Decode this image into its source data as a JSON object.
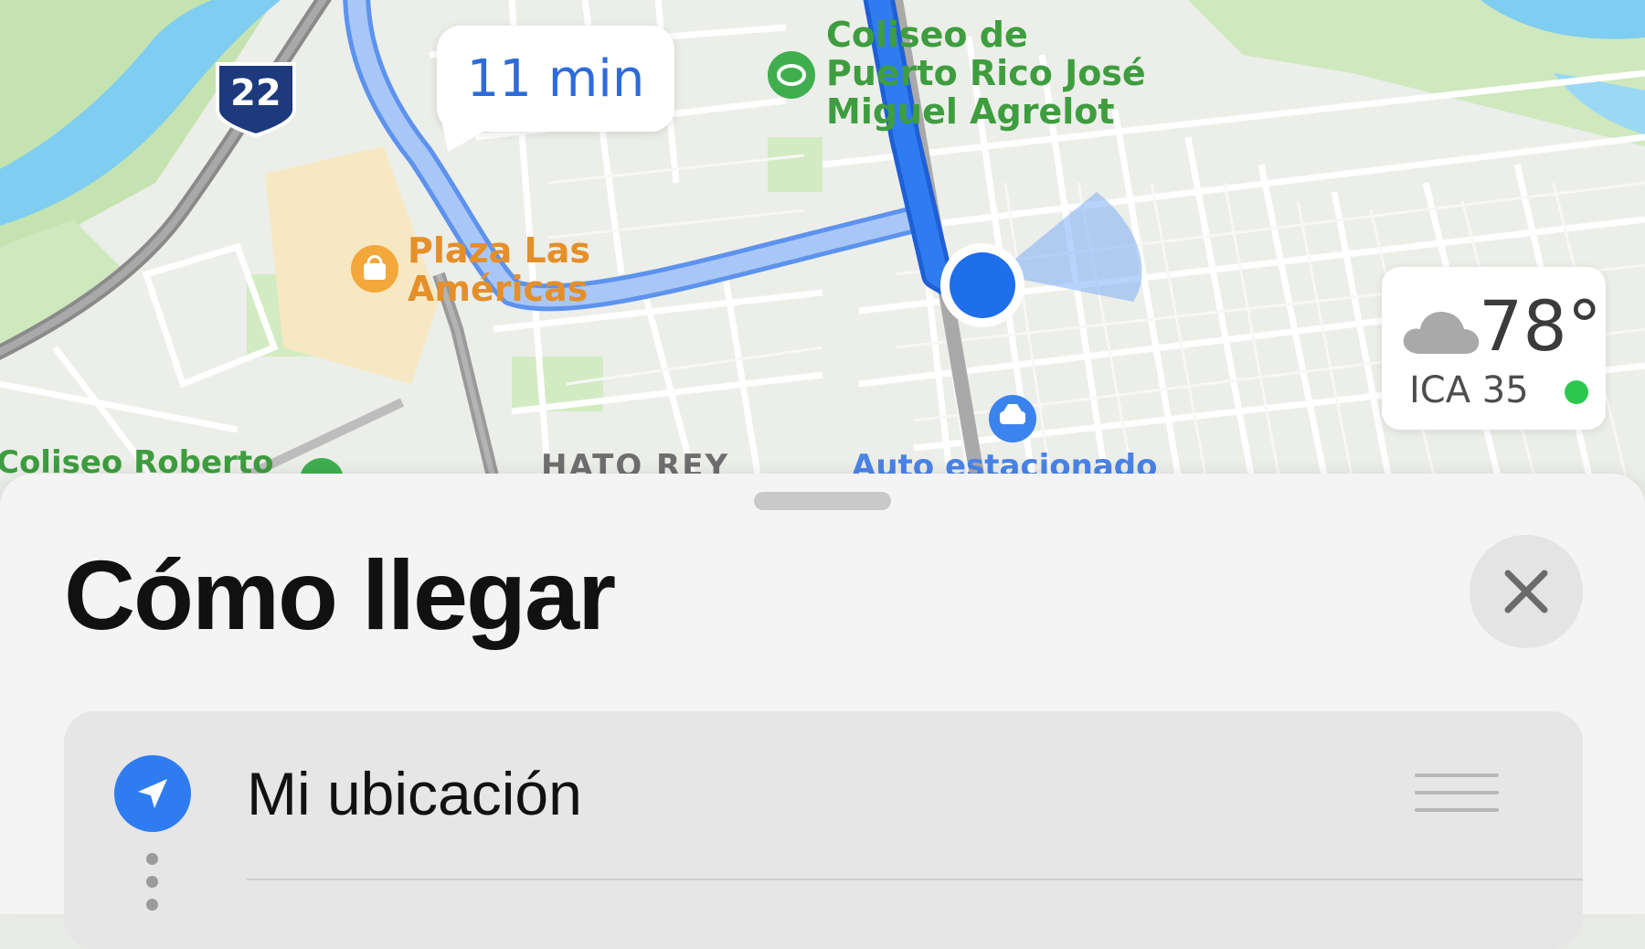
{
  "map": {
    "eta": "11 min",
    "highway_shield": "22",
    "labels": {
      "coliseo_pr": [
        "Coliseo de",
        "Puerto Rico José",
        "Miguel Agrelot"
      ],
      "plaza": [
        "Plaza Las",
        "Américas"
      ],
      "coliseo_roberto": "Coliseo Roberto",
      "hato_rey": "HATO REY",
      "parked_car": "Auto estacionado"
    },
    "colors": {
      "route_blue": "#2f7cf0",
      "alt_route": "#8cb4f7",
      "park_green": "#c8e6b5",
      "water": "#7fcdf0"
    }
  },
  "weather": {
    "temperature": "78°",
    "air_quality": "ICA 35",
    "condition_icon": "cloud-icon",
    "aqi_color": "#2cc84d"
  },
  "sheet": {
    "title": "Cómo llegar",
    "close_icon": "close-icon",
    "start": {
      "label": "Mi ubicación",
      "icon": "location-arrow-icon"
    }
  }
}
